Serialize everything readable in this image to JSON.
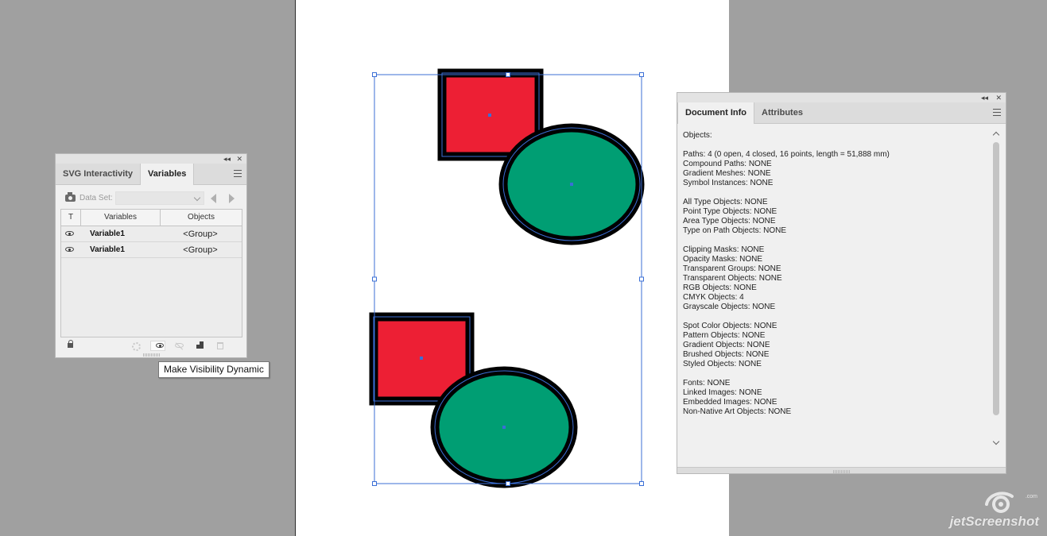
{
  "variables_panel": {
    "collapse_label": "◂◂",
    "close_label": "✕",
    "tabs": [
      {
        "label": "SVG Interactivity"
      },
      {
        "label": "Variables"
      }
    ],
    "dataset_label": "Data Set:",
    "dataset_value": "",
    "columns": {
      "type": "T",
      "variables": "Variables",
      "objects": "Objects"
    },
    "rows": [
      {
        "name": "Variable1",
        "object": "<Group>"
      },
      {
        "name": "Variable1",
        "object": "<Group>"
      }
    ]
  },
  "tooltip": {
    "text": "Make Visibility Dynamic"
  },
  "document_info_panel": {
    "collapse_label": "◂◂",
    "close_label": "✕",
    "tabs": [
      {
        "label": "Document Info"
      },
      {
        "label": "Attributes"
      }
    ],
    "lines": [
      "Objects:",
      "",
      "Paths: 4 (0 open, 4 closed, 16 points, length = 51,888 mm)",
      "Compound Paths: NONE",
      "Gradient Meshes: NONE",
      "Symbol Instances: NONE",
      "",
      "All Type Objects: NONE",
      "Point Type Objects: NONE",
      "Area Type Objects: NONE",
      "Type on Path Objects: NONE",
      "",
      "Clipping Masks: NONE",
      "Opacity Masks: NONE",
      "Transparent Groups: NONE",
      "Transparent Objects: NONE",
      "RGB Objects: NONE",
      "CMYK Objects: 4",
      "Grayscale Objects: NONE",
      "",
      "Spot Color Objects: NONE",
      "Pattern Objects: NONE",
      "Gradient Objects: NONE",
      "Brushed Objects: NONE",
      "Styled Objects: NONE",
      "",
      "Fonts: NONE",
      "Linked Images: NONE",
      "Embedded Images: NONE",
      "Non-Native Art Objects: NONE"
    ]
  },
  "colors": {
    "canvas_bg": "#a0a0a0",
    "artboard": "#ffffff",
    "square_fill": "#ed1f34",
    "circle_fill": "#009e73",
    "shape_stroke": "#000000",
    "selection": "#3b6fd6"
  },
  "watermark": {
    "text": "jetScreenshot",
    "sub": ".com"
  }
}
